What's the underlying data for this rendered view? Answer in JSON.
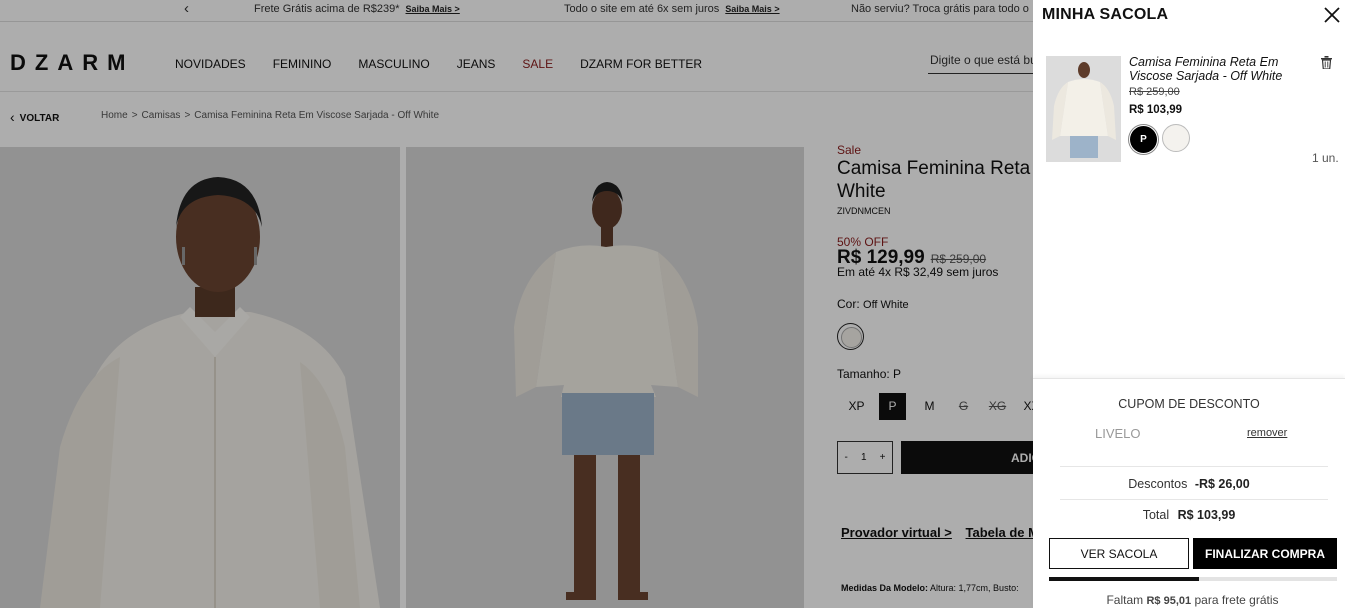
{
  "topbar": {
    "msg1": "Frete Grátis acima de R$239*",
    "msg1_link": "Saiba Mais >",
    "msg2": "Todo o site em até 6x sem juros",
    "msg2_link": "Saiba Mais >",
    "msg3": "Não serviu? Troca grátis para todo o"
  },
  "header": {
    "logo": "DZARM",
    "nav": [
      "NOVIDADES",
      "FEMININO",
      "MASCULINO",
      "JEANS",
      "SALE",
      "DZARM FOR BETTER"
    ],
    "search_placeholder": "Digite o que está bu"
  },
  "breadcrumb": {
    "back": "VOLTAR",
    "items": [
      "Home",
      "Camisas",
      "Camisa Feminina Reta Em Viscose Sarjada - Off White"
    ],
    "sep": ">"
  },
  "product": {
    "tag": "Sale",
    "title_line1": "Camisa Feminina Reta",
    "title_line2": "White",
    "sku": "ZIVDNMCEN",
    "discount": "50% OFF",
    "price": "R$ 129,99",
    "old_price": "R$ 259,00",
    "installments": "Em até 4x R$ 32,49 sem juros",
    "color_label": "Cor:",
    "color_value": "Off White",
    "size_label": "Tamanho: P",
    "sizes": [
      "XP",
      "P",
      "M",
      "G",
      "XG",
      "XX"
    ],
    "qty_minus": "-",
    "qty_value": "1",
    "qty_plus": "+",
    "add_button": "ADIC",
    "link1": "Provador virtual >",
    "link2": "Tabela de M",
    "measures_label": "Medidas Da Modelo:",
    "measures_value": "Altura: 1,77cm, Busto:"
  },
  "cart": {
    "title": "MINHA SACOLA",
    "item": {
      "name": "Camisa Feminina Reta Em Viscose Sarjada - Off White",
      "old_price": "R$ 259,00",
      "price": "R$ 103,99",
      "size": "P",
      "units": "1 un."
    },
    "coupon_title": "CUPOM DE DESCONTO",
    "coupon_code": "LIVELO",
    "remove": "remover",
    "discounts_label": "Descontos",
    "discounts_value": "-R$ 26,00",
    "total_label": "Total",
    "total_value": "R$ 103,99",
    "view_bag": "VER SACOLA",
    "checkout": "FINALIZAR COMPRA",
    "free_shipping_progress": 0.52,
    "shipping_prefix": "Faltam",
    "shipping_amount": "R$ 95,01",
    "shipping_suffix": "para frete grátis"
  }
}
